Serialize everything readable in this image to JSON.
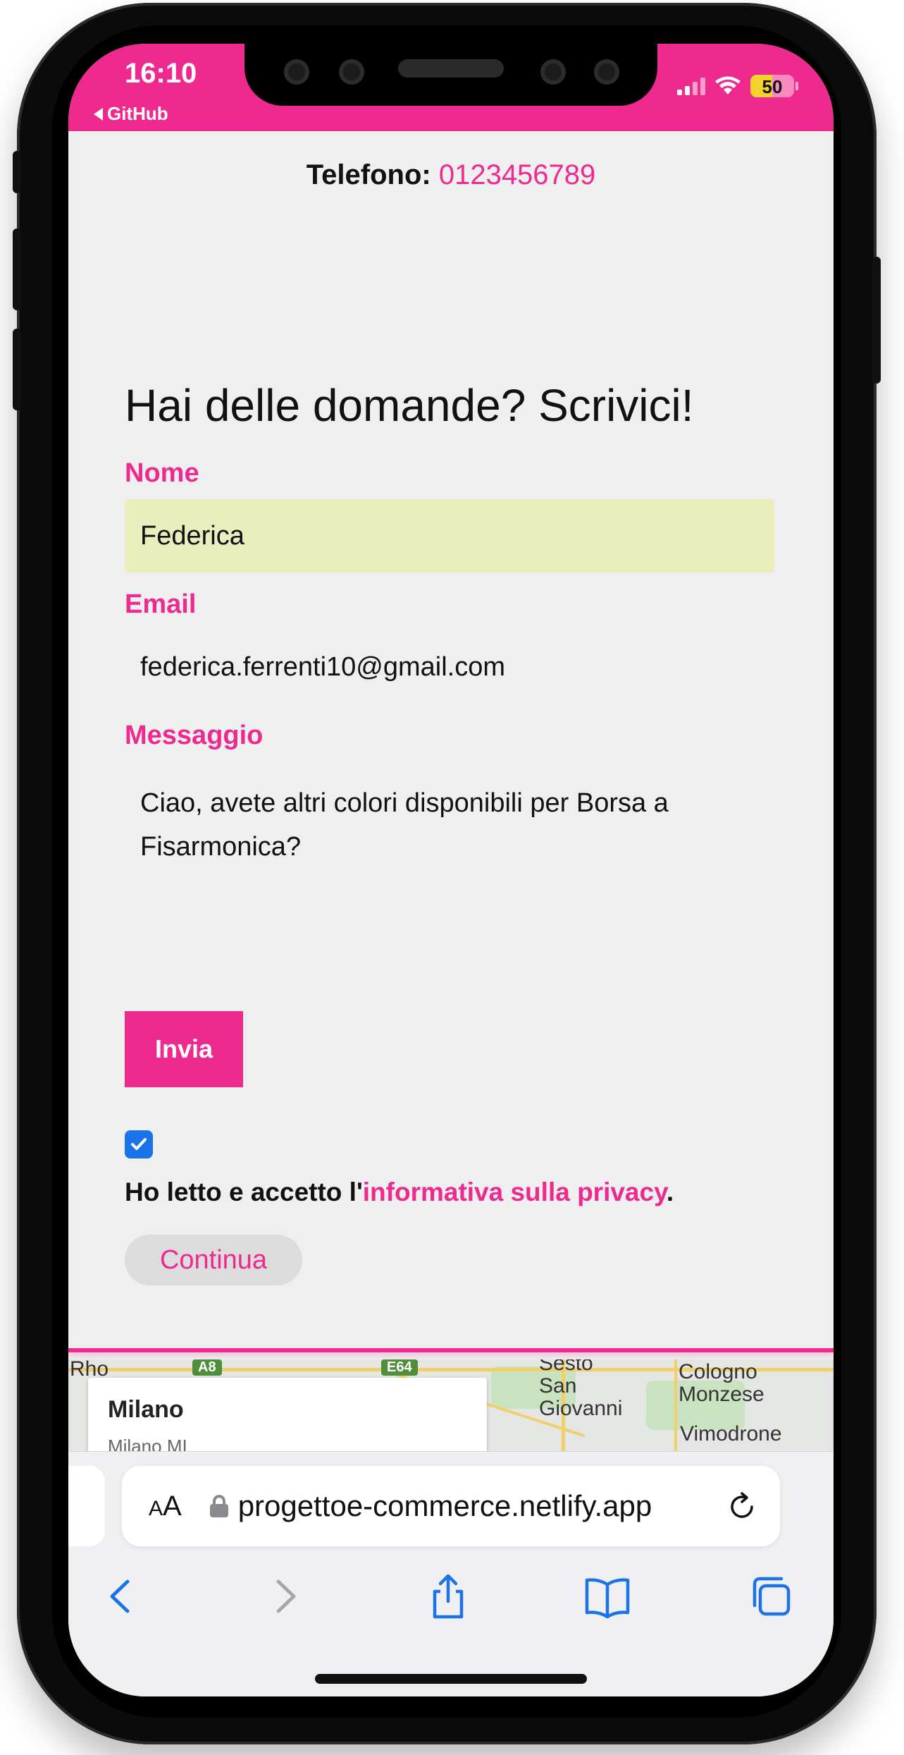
{
  "status_bar": {
    "time": "16:10",
    "back_app": "GitHub",
    "battery": "50",
    "battery_level": 0.5,
    "background": "#ee2a8e"
  },
  "contact": {
    "phone_label": "Telefono:",
    "phone_number": "0123456789"
  },
  "form": {
    "title": "Hai delle domande? Scrivici!",
    "name_label": "Nome",
    "name_value": "Federica",
    "email_label": "Email",
    "email_value": "federica.ferrenti10@gmail.com",
    "message_label": "Messaggio",
    "message_value": "Ciao, avete altri colori disponibili per Borsa a Fisarmonica?",
    "submit_label": "Invia",
    "privacy_checked": true,
    "privacy_prefix": "Ho letto e accetto l'",
    "privacy_link": "informativa sulla privacy",
    "privacy_suffix": ".",
    "continue_label": "Continua"
  },
  "map": {
    "card_title": "Milano",
    "card_subtitle": "Milano MI",
    "places": [
      "Rho",
      "Sesto San Giovanni",
      "Cologno Monzese",
      "Vimodrone"
    ],
    "road_badges": [
      "A8",
      "E64"
    ]
  },
  "browser": {
    "text_size_label": "AA",
    "url": "progettoe-commerce.netlify.app"
  },
  "colors": {
    "accent": "#ee2a8e",
    "safari_blue": "#1a73e8"
  },
  "icons": [
    "back-arrow-icon",
    "forward-arrow-icon",
    "share-icon",
    "bookmarks-icon",
    "tabs-icon",
    "reload-icon",
    "lock-icon",
    "checkmark-icon",
    "wifi-icon",
    "signal-icon",
    "battery-icon"
  ]
}
